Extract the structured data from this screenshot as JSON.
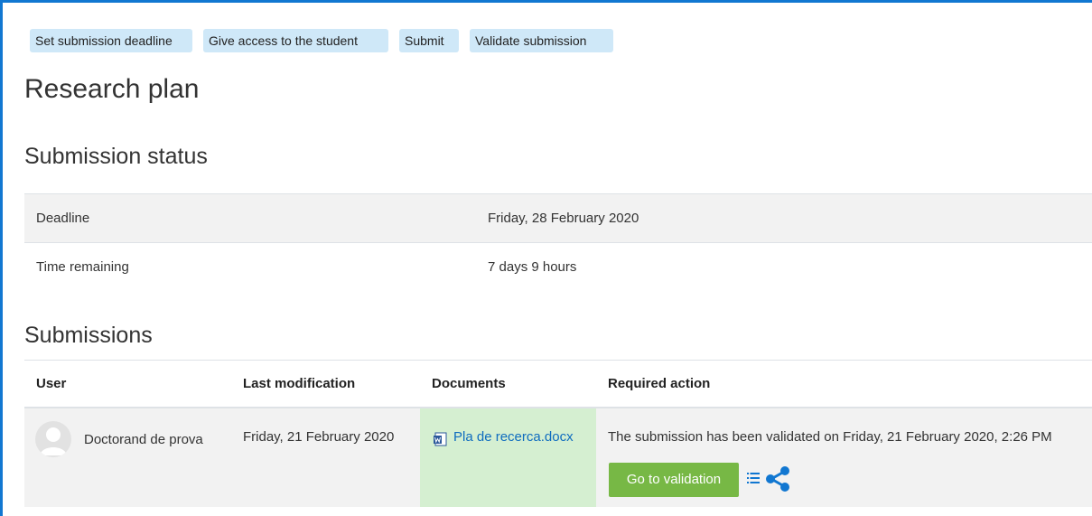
{
  "actions": {
    "set_deadline": "Set submission deadline",
    "give_access": "Give access to the student",
    "submit": "Submit",
    "validate": "Validate submission"
  },
  "page_title": "Research plan",
  "submission_status": {
    "heading": "Submission status",
    "rows": [
      {
        "label": "Deadline",
        "value": "Friday, 28 February 2020"
      },
      {
        "label": "Time remaining",
        "value": "7 days 9 hours"
      }
    ]
  },
  "submissions": {
    "heading": "Submissions",
    "columns": [
      "User",
      "Last modification",
      "Documents",
      "Required action"
    ],
    "rows": [
      {
        "user": "Doctorand de prova",
        "last_modification": "Friday, 21 February 2020",
        "document": "Pla de recerca.docx",
        "required_action": "The submission has been validated on Friday, 21 February 2020, 2:26 PM",
        "action_button": "Go to validation"
      }
    ]
  },
  "icons": {
    "avatar": "user-avatar-icon",
    "document": "word-document-icon",
    "list": "list-icon",
    "share": "share-icon"
  },
  "colors": {
    "frame_border": "#1177d1",
    "action_button_bg": "#cfe8f8",
    "link": "#0f6cbf",
    "documents_cell_bg": "#d5efd1",
    "validation_button_bg": "#77b845",
    "row_shade": "#f2f2f2"
  }
}
